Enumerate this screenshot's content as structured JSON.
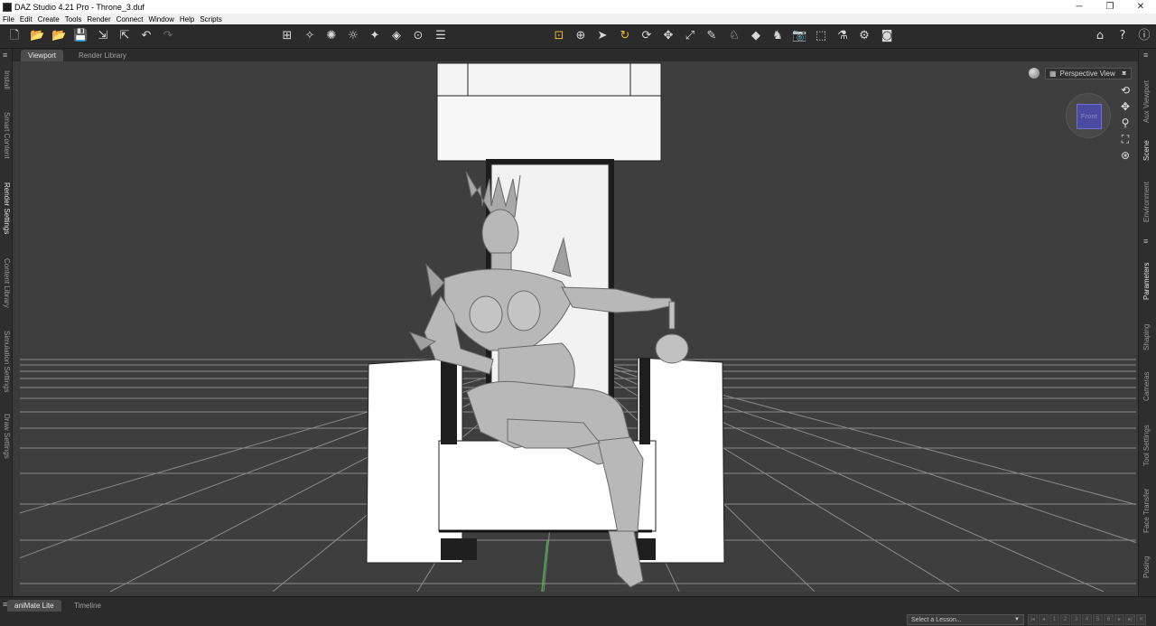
{
  "window": {
    "title": "DAZ Studio 4.21 Pro - Throne_3.duf",
    "minimize": "─",
    "maximize": "❐",
    "close": "✕"
  },
  "menu": [
    "File",
    "Edit",
    "Create",
    "Tools",
    "Render",
    "Connect",
    "Window",
    "Help",
    "Scripts"
  ],
  "toolbar": {
    "file_icons": [
      "new-file-icon",
      "open-file-icon",
      "open-recent-icon",
      "save-icon",
      "import-icon",
      "export-icon",
      "undo-icon",
      "redo-icon"
    ],
    "create_icons": [
      "create-camera-icon",
      "create-light-icon",
      "create-spotlight-icon",
      "create-distant-light-icon",
      "create-point-light-icon",
      "create-primitive-icon",
      "create-null-icon",
      "list-icon"
    ],
    "tool_icons": [
      "node-selection-icon",
      "universal-tool-icon",
      "pointer-icon",
      "rotate-tool-icon",
      "twist-tool-icon",
      "translate-tool-icon",
      "scale-tool-icon",
      "joint-editor-icon",
      "active-pose-icon",
      "surface-selection-icon",
      "geometry-editor-icon",
      "render-icon",
      "spot-render-icon",
      "iray-section-icon",
      "render-settings-icon",
      "screenshot-icon"
    ],
    "right_icons": [
      "home-icon",
      "whats-this-icon",
      "help-icon"
    ]
  },
  "left_tabs": [
    {
      "label": "Install",
      "active": false
    },
    {
      "label": "Smart Content",
      "active": false
    },
    {
      "label": "Render Settings",
      "active": true
    },
    {
      "label": "Content Library",
      "active": false
    },
    {
      "label": "Simulation Settings",
      "active": false
    },
    {
      "label": "Draw Settings",
      "active": false
    }
  ],
  "right_tabs": [
    {
      "label": "Aux Viewport",
      "active": false
    },
    {
      "label": "Scene",
      "active": true
    },
    {
      "label": "Environment",
      "active": false
    },
    {
      "label": "Parameters",
      "active": true
    },
    {
      "label": "Shaping",
      "active": false
    },
    {
      "label": "Cameras",
      "active": false
    },
    {
      "label": "Tool Settings",
      "active": false
    },
    {
      "label": "Face Transfer",
      "active": false
    },
    {
      "label": "Posing",
      "active": false
    }
  ],
  "center_tabs": [
    {
      "label": "Viewport",
      "active": true
    },
    {
      "label": "Render Library",
      "active": false
    }
  ],
  "viewport": {
    "view_label": "Perspective View",
    "cube_face": "Front",
    "nav_icons": [
      "orbit-icon",
      "pan-icon",
      "zoom-icon",
      "frame-icon",
      "reset-view-icon"
    ]
  },
  "bottom_tabs": [
    {
      "label": "aniMate Lite",
      "active": true
    },
    {
      "label": "Timeline",
      "active": false
    }
  ],
  "lesson": {
    "placeholder": "Select a Lesson..."
  },
  "colors": {
    "accent": "#e8b830",
    "background": "#3e3e3e",
    "panel": "#2b2b2b"
  }
}
